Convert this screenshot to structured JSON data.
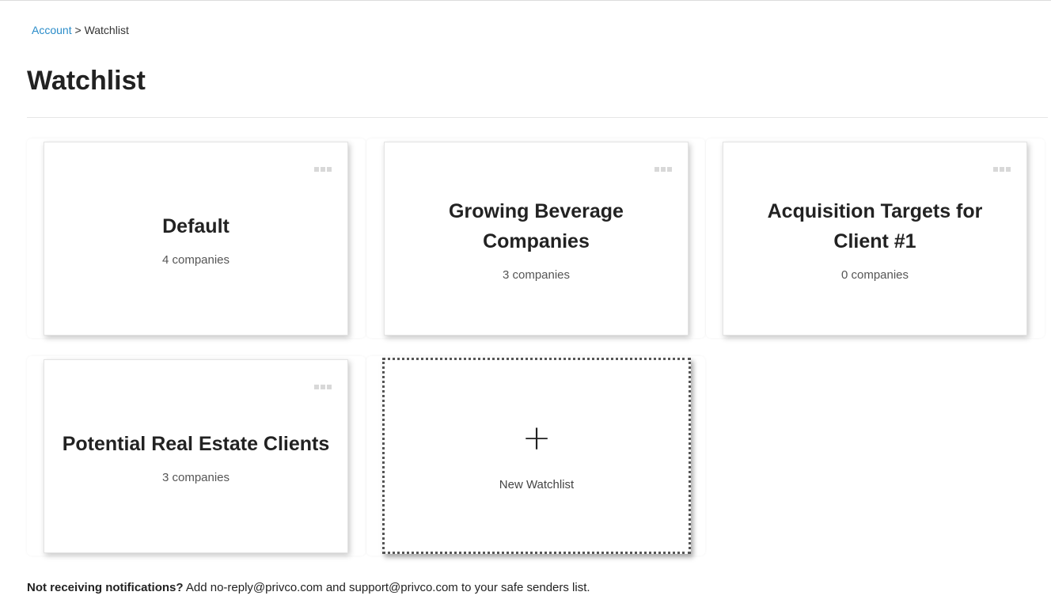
{
  "breadcrumb": {
    "link": "Account",
    "separator": " > ",
    "current": "Watchlist"
  },
  "page": {
    "title": "Watchlist"
  },
  "watchlists": [
    {
      "name": "Default",
      "count": "4 companies"
    },
    {
      "name": "Growing Beverage Companies",
      "count": "3 companies"
    },
    {
      "name": "Acquisition Targets for Client #1",
      "count": "0 companies"
    },
    {
      "name": "Potential Real Estate Clients",
      "count": "3 companies"
    }
  ],
  "new_watchlist": {
    "icon": "+",
    "label": "New Watchlist"
  },
  "footer": {
    "bold": "Not receiving notifications?",
    "text": " Add no-reply@privco.com and support@privco.com to your safe senders list."
  },
  "colors": {
    "link": "#2a8cc9",
    "menu_dots": "#d8d8d8"
  }
}
